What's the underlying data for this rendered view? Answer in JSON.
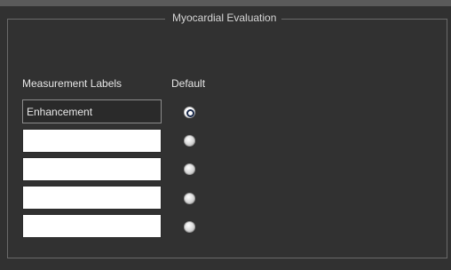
{
  "section": {
    "title": "Myocardial Evaluation"
  },
  "columns": {
    "labels_header": "Measurement Labels",
    "default_header": "Default"
  },
  "rows": [
    {
      "label": "Enhancement",
      "editable": false,
      "selected": true
    },
    {
      "label": "",
      "editable": true,
      "selected": false
    },
    {
      "label": "",
      "editable": true,
      "selected": false
    },
    {
      "label": "",
      "editable": true,
      "selected": false
    },
    {
      "label": "",
      "editable": true,
      "selected": false
    }
  ]
}
